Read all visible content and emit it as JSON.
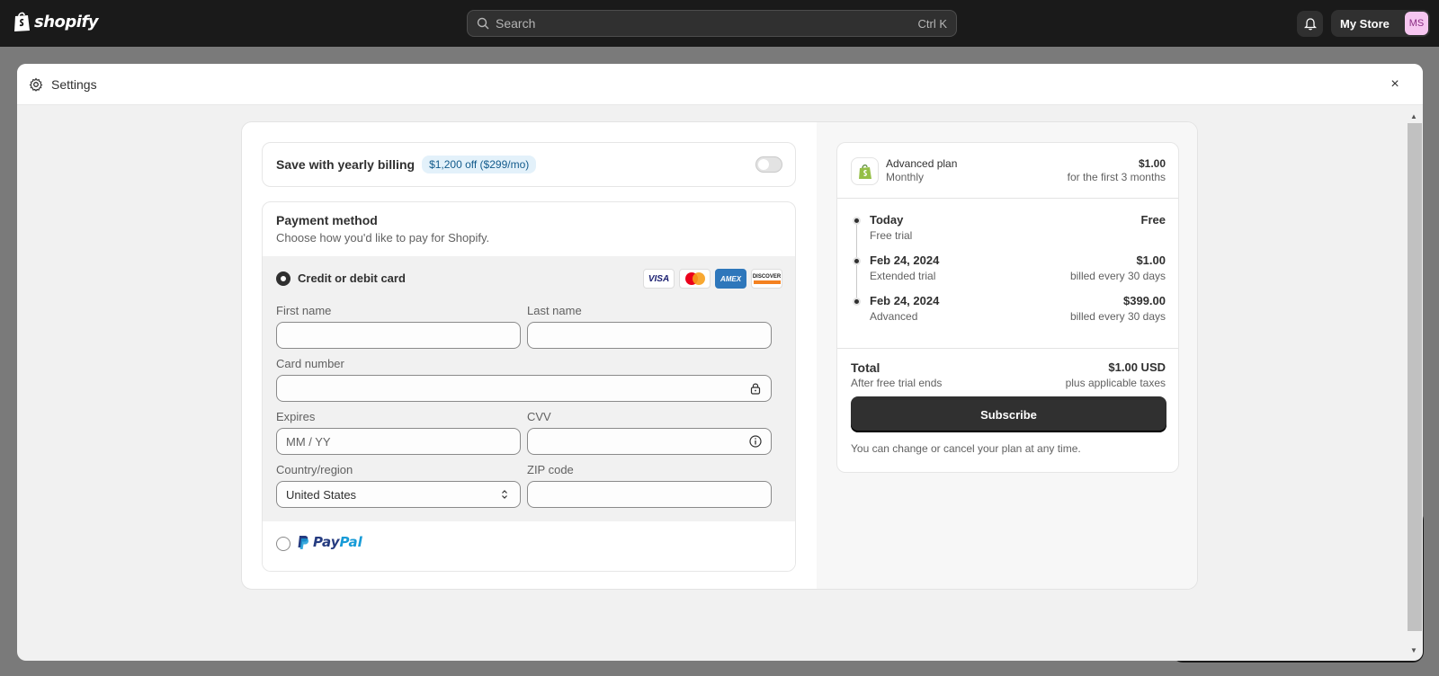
{
  "topbar": {
    "logo_text": "shopify",
    "search_placeholder": "Search",
    "search_shortcut": "Ctrl K",
    "store_name": "My Store",
    "avatar_initials": "MS"
  },
  "modal": {
    "title": "Settings",
    "close_label": "×"
  },
  "yearly": {
    "label": "Save with yearly billing",
    "badge": "$1,200 off ($299/mo)",
    "toggle_on": false
  },
  "payment": {
    "title": "Payment method",
    "subtitle": "Choose how you'd like to pay for Shopify.",
    "card_option_label": "Credit or debit card",
    "card_brands": [
      "VISA",
      "Mastercard",
      "AMEX",
      "DISCOVER"
    ],
    "fields": {
      "first_name_label": "First name",
      "last_name_label": "Last name",
      "card_number_label": "Card number",
      "expires_label": "Expires",
      "expires_placeholder": "MM / YY",
      "cvv_label": "CVV",
      "country_label": "Country/region",
      "country_value": "United States",
      "zip_label": "ZIP code"
    },
    "paypal_label_1": "Pay",
    "paypal_label_2": "Pal"
  },
  "summary": {
    "plan_name": "Advanced plan",
    "plan_cycle": "Monthly",
    "plan_price": "$1.00",
    "plan_price_note": "for the first 3 months",
    "timeline": [
      {
        "date": "Today",
        "desc": "Free trial",
        "amount": "Free",
        "note": ""
      },
      {
        "date": "Feb 24, 2024",
        "desc": "Extended trial",
        "amount": "$1.00",
        "note": "billed every 30 days"
      },
      {
        "date": "Feb 24, 2024",
        "desc": "Advanced",
        "amount": "$399.00",
        "note": "billed every 30 days"
      }
    ],
    "total_label": "Total",
    "total_sub": "After free trial ends",
    "total_amount": "$1.00 USD",
    "total_note": "plus applicable taxes",
    "subscribe_label": "Subscribe",
    "footer_note": "You can change or cancel your plan at any time."
  }
}
